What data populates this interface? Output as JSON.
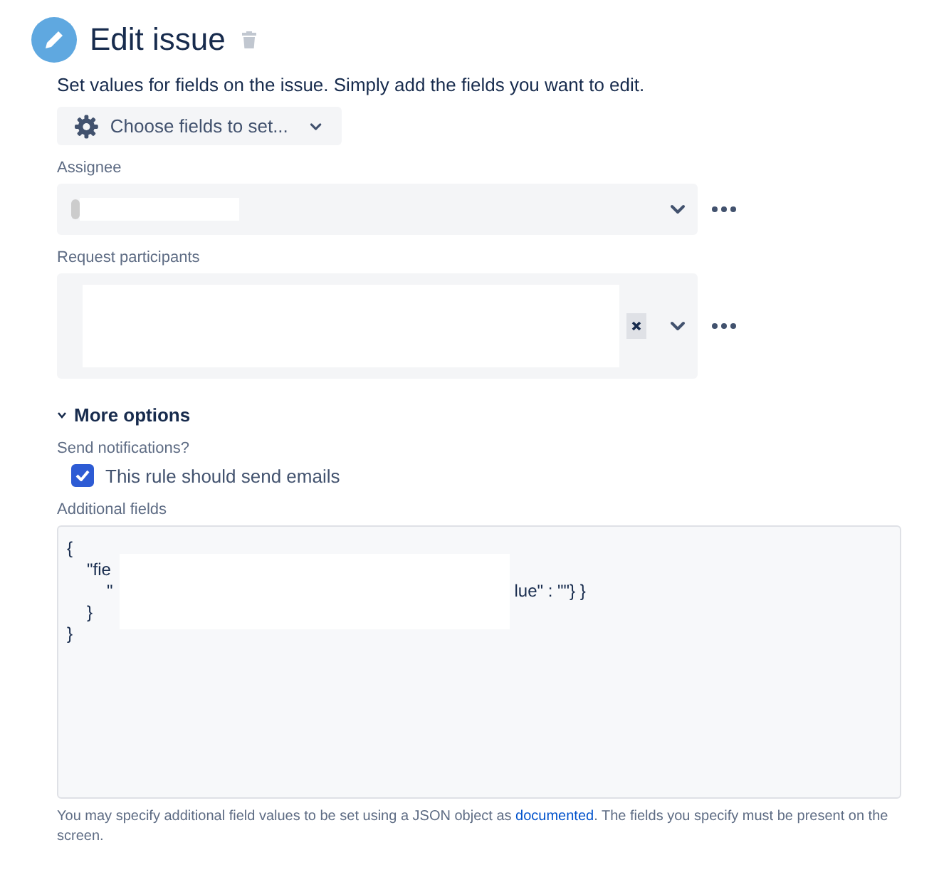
{
  "header": {
    "title": "Edit issue",
    "description": "Set values for fields on the issue. Simply add the fields you want to edit."
  },
  "choose_button": {
    "label": "Choose fields to set..."
  },
  "fields": [
    {
      "label": "Assignee",
      "kind": "single"
    },
    {
      "label": "Request participants",
      "kind": "multi"
    }
  ],
  "more_options": {
    "label": "More options",
    "expanded": true
  },
  "notifications": {
    "label": "Send notifications?",
    "checkbox": {
      "label": "This rule should send emails",
      "checked": true
    }
  },
  "additional_fields": {
    "label": "Additional fields",
    "lines": [
      {
        "head": "{",
        "children": [
          {
            "head": "\"fie",
            "children": [
              {
                "head": "\"",
                "tail": "lue\" : \"\"} }"
              }
            ]
          },
          {
            "head": "}"
          }
        ]
      },
      {
        "head": "}"
      }
    ]
  },
  "help": {
    "before": "You may specify additional field values to be set using a JSON object as",
    "link": "documented",
    "after": ". The fields you specify must be present on the screen."
  }
}
